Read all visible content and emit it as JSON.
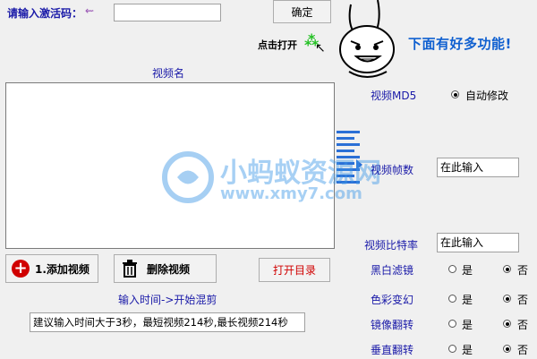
{
  "activation": {
    "label": "请输入激活码：",
    "confirm": "确定"
  },
  "promo": {
    "click_open": "点击打开",
    "more_features": "下面有好多功能!"
  },
  "video": {
    "name_label": "视频名",
    "add_button": "1.添加视频",
    "delete_button": "删除视频",
    "open_dir_button": "打开目录",
    "time_label": "输入时间->开始混剪",
    "hint": "建议输入时间大于3秒，最短视频214秒,最长视频214秒"
  },
  "settings": {
    "md5_label": "视频MD5",
    "md5_option": "自动修改",
    "framerate_label": "视频帧数",
    "framerate_value": "在此输入",
    "bitrate_label": "视频比特率",
    "bitrate_value": "在此输入",
    "rows": [
      {
        "label": "黑白滤镜",
        "yes": "是",
        "no": "否",
        "selected": "no"
      },
      {
        "label": "色彩变幻",
        "yes": "是",
        "no": "否",
        "selected": "no"
      },
      {
        "label": "镜像翻转",
        "yes": "是",
        "no": "否",
        "selected": "no"
      },
      {
        "label": "垂直翻转",
        "yes": "是",
        "no": "否",
        "selected": "no"
      }
    ]
  },
  "watermark": {
    "title": "小蚂蚁资源网",
    "url": "www.xmy7.com"
  },
  "colors": {
    "accent_red": "#d00000",
    "label_blue": "#1a1aa8",
    "promo_blue": "#1060d0"
  }
}
